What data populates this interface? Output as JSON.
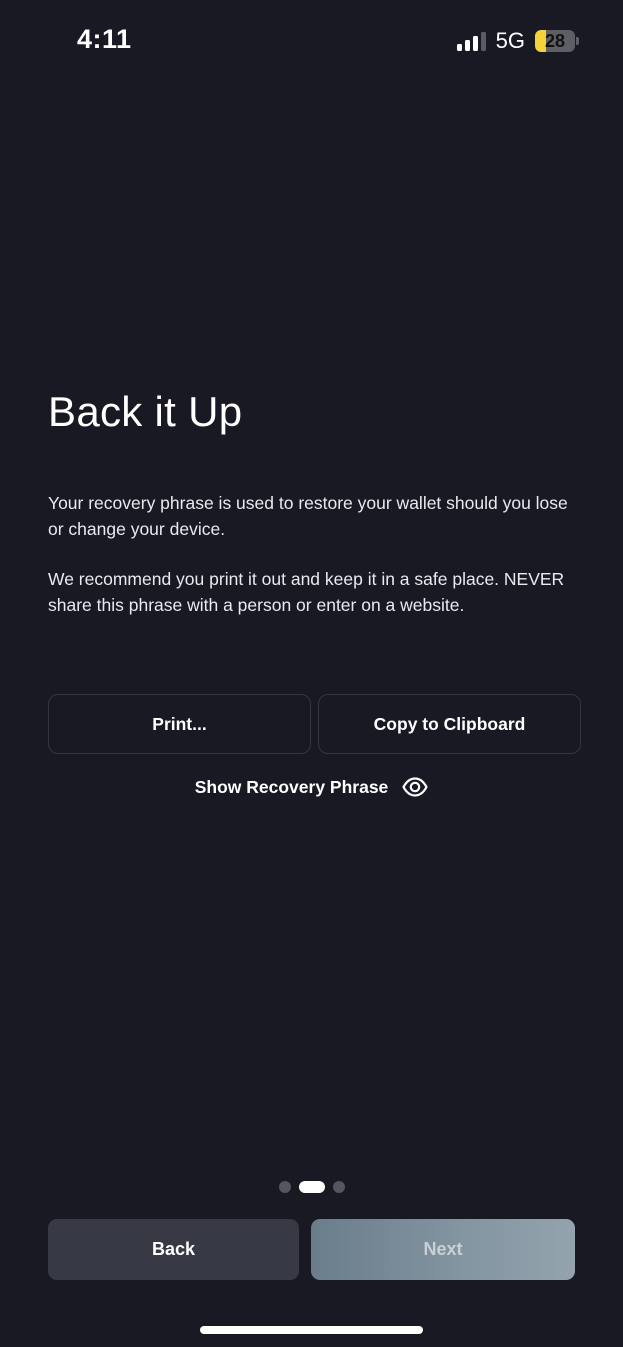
{
  "status_bar": {
    "time": "4:11",
    "network": "5G",
    "battery_level": "28",
    "battery_fraction": 0.28,
    "signal_bars_active": 3,
    "signal_bars_total": 4
  },
  "title": "Back it Up",
  "paragraphs": [
    "Your recovery phrase is used to restore your wallet should you lose or change your device.",
    "We recommend you print it out and keep it in a safe place. NEVER share this phrase with a person or enter on a website."
  ],
  "actions": {
    "print_label": "Print...",
    "copy_label": "Copy to Clipboard",
    "show_phrase_label": "Show Recovery Phrase",
    "show_phrase_icon": "eye-icon"
  },
  "pager": {
    "total": 3,
    "active_index": 1
  },
  "nav": {
    "back_label": "Back",
    "next_label": "Next"
  },
  "colors": {
    "background": "#181923",
    "battery_fill": "#f4d23a",
    "next_button": "#8496a2",
    "back_button": "#373944"
  }
}
